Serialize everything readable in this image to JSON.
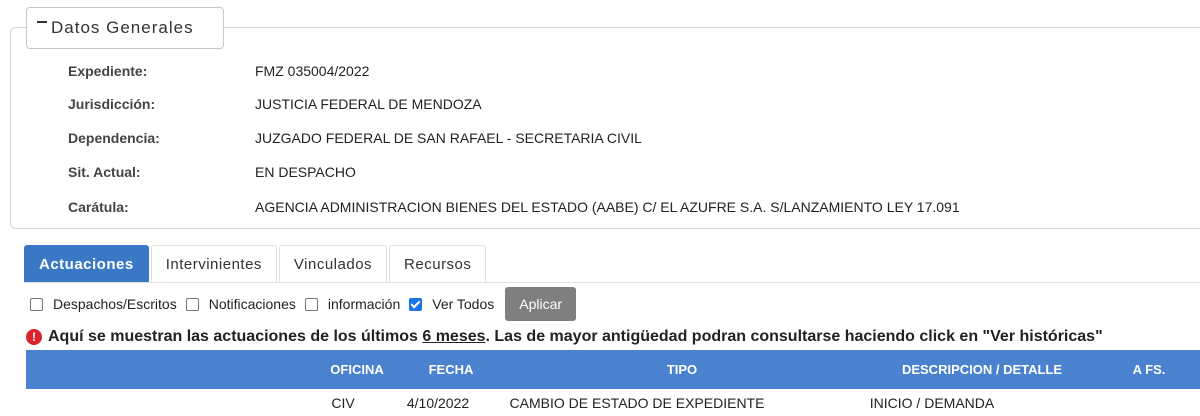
{
  "general": {
    "legend": "Datos Generales",
    "rows": [
      {
        "label": "Expediente:",
        "value": "FMZ 035004/2022"
      },
      {
        "label": "Jurisdicción:",
        "value": "JUSTICIA FEDERAL DE MENDOZA"
      },
      {
        "label": "Dependencia:",
        "value": "JUZGADO FEDERAL DE SAN RAFAEL - SECRETARIA CIVIL"
      },
      {
        "label": "Sit. Actual:",
        "value": "EN DESPACHO"
      },
      {
        "label": "Carátula:",
        "value": "AGENCIA ADMINISTRACION BIENES DEL ESTADO (AABE) C/ EL AZUFRE S.A. S/LANZAMIENTO LEY 17.091"
      }
    ]
  },
  "tabs": [
    {
      "label": "Actuaciones",
      "active": true
    },
    {
      "label": "Intervinientes",
      "active": false
    },
    {
      "label": "Vinculados",
      "active": false
    },
    {
      "label": "Recursos",
      "active": false
    }
  ],
  "filters": [
    {
      "label": "Despachos/Escritos",
      "checked": false
    },
    {
      "label": "Notificaciones",
      "checked": false
    },
    {
      "label": "información",
      "checked": false
    },
    {
      "label": "Ver Todos",
      "checked": true
    }
  ],
  "apply_label": "Aplicar",
  "notice": {
    "icon": "!",
    "before": "Aquí se muestran las actuaciones de los últimos ",
    "underlined": "6 meses",
    "after": ". Las de mayor antigüedad podran consultarse haciendo click en \"Ver históricas\""
  },
  "table": {
    "headers": [
      "OFICINA",
      "FECHA",
      "TIPO",
      "DESCRIPCION / DETALLE",
      "A FS."
    ],
    "rows": [
      [
        "CIV",
        "4/10/2022",
        "CAMBIO DE ESTADO DE EXPEDIENTE",
        "INICIO / DEMANDA",
        ""
      ]
    ]
  },
  "colors": {
    "accent": "#3a78c6",
    "header": "#4a82cf",
    "alert": "#d9232d",
    "button": "#7f7f7f"
  }
}
